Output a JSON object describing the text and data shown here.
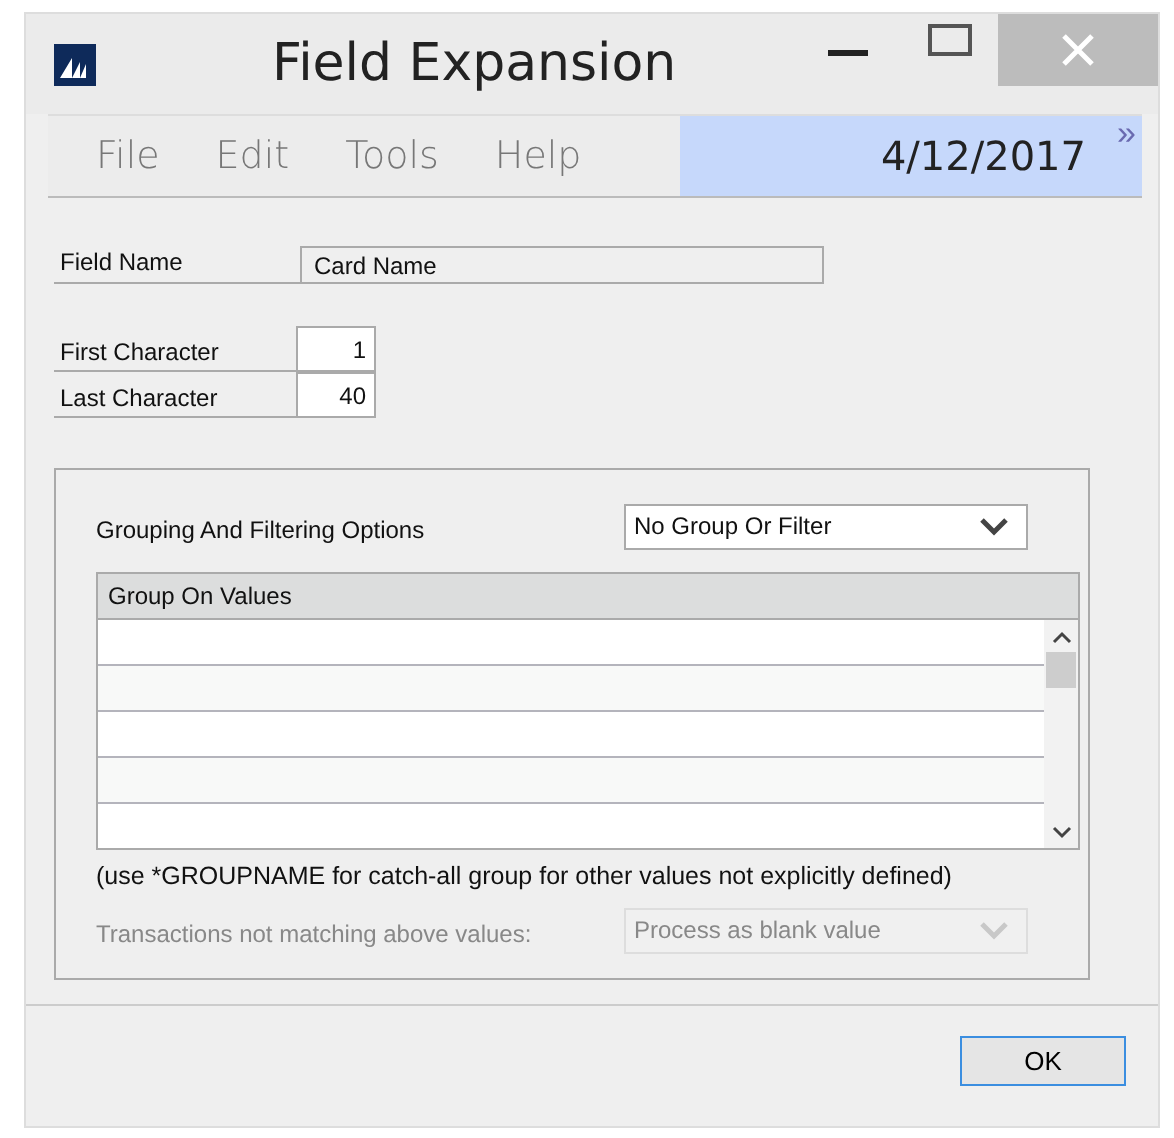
{
  "window": {
    "title": "Field Expansion"
  },
  "menu": [
    "File",
    "Edit",
    "Tools",
    "Help"
  ],
  "date": "4/12/2017",
  "more": "»",
  "field_name": {
    "label": "Field Name",
    "value": "Card Name"
  },
  "characters": [
    {
      "label": "First Character",
      "value": "1"
    },
    {
      "label": "Last Character",
      "value": "40"
    }
  ],
  "grouping": {
    "label": "Grouping And Filtering Options",
    "value": "No Group Or Filter",
    "disabled": false
  },
  "table": {
    "columns": [
      "Group On Values"
    ]
  },
  "note": "(use *GROUPNAME for catch-all group for other values not explicitly defined)",
  "unmatched": {
    "label": "Transactions not matching above values:",
    "value": "Process as blank value",
    "disabled": true
  },
  "buttons": [
    "OK"
  ]
}
